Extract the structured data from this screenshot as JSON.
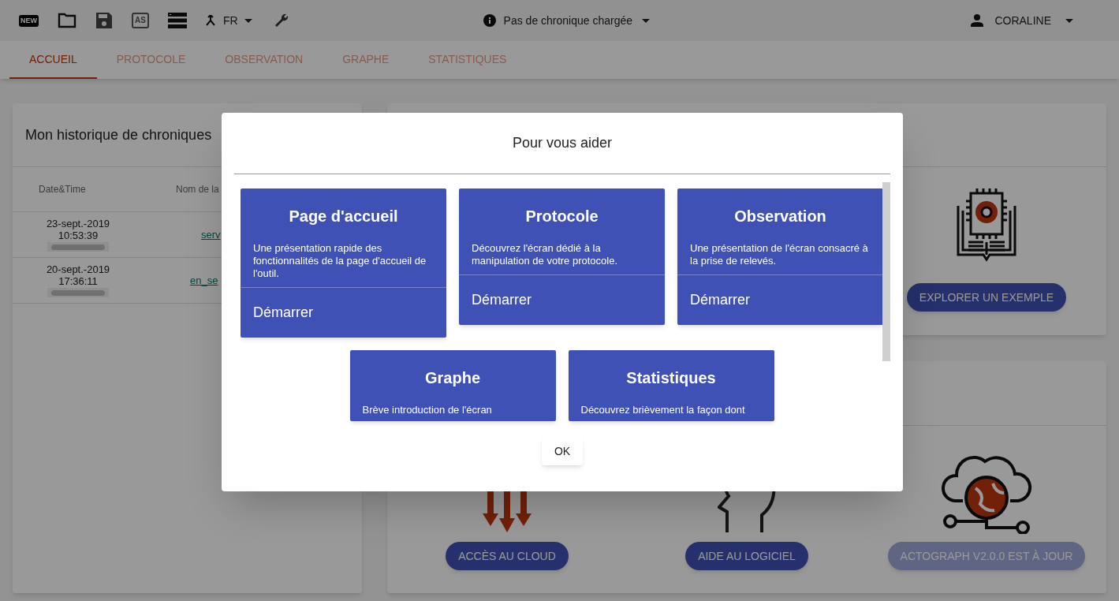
{
  "toolbar": {
    "new_icon_text": "NEW",
    "save_as_icon_text": "AS",
    "language": "FR",
    "chronicle": "Pas de chronique chargée",
    "user": "CORALINE"
  },
  "tabs": [
    {
      "label": "ACCUEIL",
      "selected": true
    },
    {
      "label": "PROTOCOLE",
      "selected": false
    },
    {
      "label": "OBSERVATION",
      "selected": false
    },
    {
      "label": "GRAPHE",
      "selected": false
    },
    {
      "label": "STATISTIQUES",
      "selected": false
    }
  ],
  "history": {
    "title": "Mon historique de chroniques",
    "columns": [
      "Date&Time",
      "Nom de la"
    ],
    "rows": [
      {
        "date": "23-sept.-2019",
        "time": "10:53:39",
        "name": "serv",
        "level": 1
      },
      {
        "date": "20-sept.-2019",
        "time": "17:36:11",
        "name": "en_se",
        "level": 1
      }
    ]
  },
  "top_actions": [
    {
      "kind": "example",
      "label": "EXPLORER UN EXEMPLE",
      "disabled": false
    }
  ],
  "bottom_actions": [
    {
      "kind": "cloud",
      "label": "ACCÈS AU CLOUD",
      "disabled": false
    },
    {
      "kind": "help",
      "label": "AIDE AU LOGICIEL",
      "disabled": false
    },
    {
      "kind": "update",
      "label": "ACTOGRAPH V2.0.0 EST À JOUR",
      "disabled": true
    }
  ],
  "dialog": {
    "title": "Pour vous aider",
    "cards": [
      {
        "title": "Page d'accueil",
        "description": "Une présentation rapide des fonctionnalités de la page d'accueil de l'outil.",
        "action": "Démarrer"
      },
      {
        "title": "Protocole",
        "description": "Découvrez l'écran dédié à la manipulation de votre protocole.",
        "action": "Démarrer"
      },
      {
        "title": "Observation",
        "description": "Une présentation de l'écran consacré à la prise de relevés.",
        "action": "Démarrer"
      },
      {
        "title": "Graphe",
        "description": "Brève introduction de l'écran"
      },
      {
        "title": "Statistiques",
        "description": "Découvrez brièvement la façon dont"
      }
    ],
    "ok_button": "OK"
  }
}
